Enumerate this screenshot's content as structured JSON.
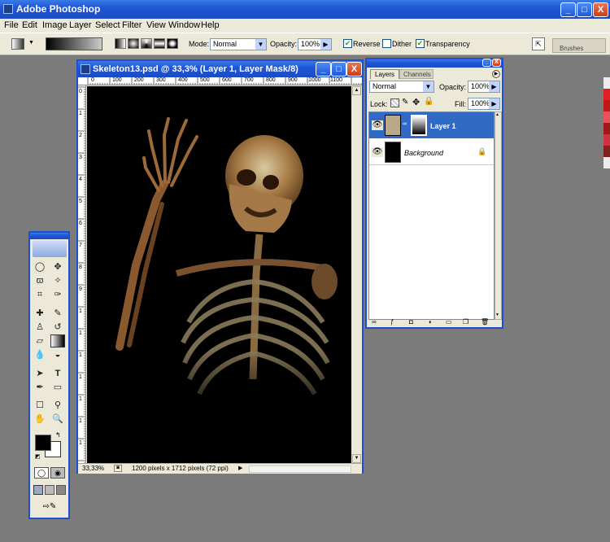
{
  "app": {
    "title": "Adobe Photoshop",
    "buttons": {
      "minimize": "_",
      "maximize": "□",
      "close": "X"
    }
  },
  "menu": [
    "File",
    "Edit",
    "Image",
    "Layer",
    "Select",
    "Filter",
    "View",
    "Window",
    "Help"
  ],
  "options": {
    "mode_label": "Mode:",
    "mode_value": "Normal",
    "opacity_label": "Opacity:",
    "opacity_value": "100%",
    "reverse_label": "Reverse",
    "dither_label": "Dither",
    "transparency_label": "Transparency",
    "brushes_tab": "Brushes"
  },
  "document": {
    "title": "Skeleton13.psd @ 33,3% (Layer 1, Layer Mask/8)",
    "zoom": "33,33%",
    "info": "1200 pixels x 1712 pixels (72 ppi)",
    "ruler_h": [
      "0",
      "100",
      "200",
      "300",
      "400",
      "500",
      "600",
      "700",
      "800",
      "900",
      "1000",
      "1100"
    ],
    "ruler_v": [
      "0",
      "1",
      "2",
      "3",
      "4",
      "5",
      "6",
      "7",
      "8",
      "9",
      "1",
      "1",
      "1",
      "1",
      "1",
      "1",
      "1"
    ]
  },
  "layers_panel": {
    "tabs": [
      "Layers",
      "Channels"
    ],
    "blend_mode": "Normal",
    "opacity_label": "Opacity:",
    "opacity_value": "100%",
    "lock_label": "Lock:",
    "fill_label": "Fill:",
    "fill_value": "100%",
    "layers": [
      {
        "name": "Layer 1",
        "selected": true
      },
      {
        "name": "Background",
        "selected": false
      }
    ]
  },
  "colors": {
    "accent": "#1b51d0",
    "selected_layer": "#316ac5",
    "foreground": "#000000",
    "background": "#ffffff"
  }
}
